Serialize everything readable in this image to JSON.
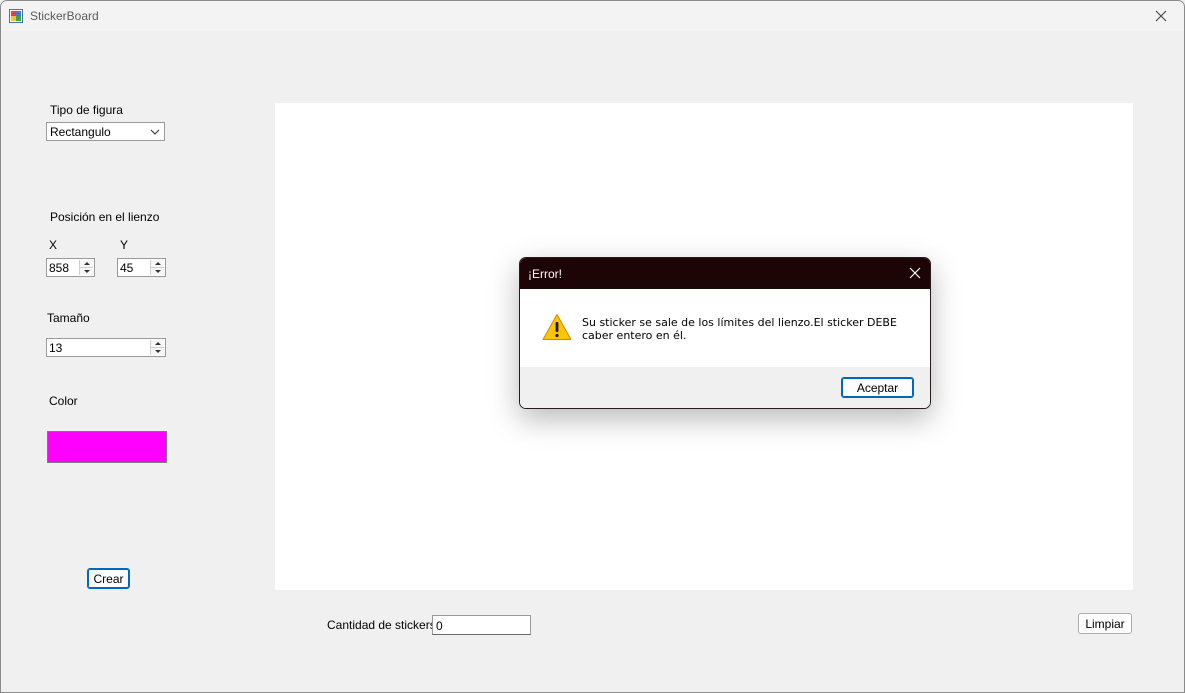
{
  "window": {
    "title": "StickerBoard"
  },
  "shape": {
    "label": "Tipo de figura",
    "selected": "Rectangulo"
  },
  "position": {
    "label": "Posición en el lienzo",
    "x_label": "X",
    "y_label": "Y",
    "x_value": "858",
    "y_value": "45"
  },
  "size": {
    "label": "Tamaño",
    "value": "13"
  },
  "color": {
    "label": "Color",
    "value": "#ff00ff"
  },
  "actions": {
    "create_label": "Crear",
    "clear_label": "Limpiar"
  },
  "counter": {
    "label": "Cantidad de stickers:",
    "value": "0"
  },
  "dialog": {
    "title": "¡Error!",
    "message": "Su sticker se sale de los límites del lienzo.El sticker DEBE caber entero en él.",
    "ok_label": "Aceptar",
    "icon": "warning-icon"
  }
}
